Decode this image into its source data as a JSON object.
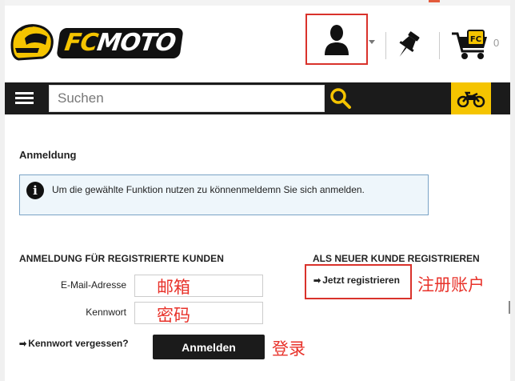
{
  "header": {
    "logo_text_fc": "FC",
    "logo_text_moto": "MOTO",
    "cart_count": "0"
  },
  "search": {
    "placeholder": "Suchen"
  },
  "login": {
    "title": "Anmeldung",
    "info_message": "Um die gewählte Funktion nutzen zu könnenmeldemn Sie sich anmelden.",
    "registered_heading": "ANMELDUNG FÜR REGISTRIERTE KUNDEN",
    "email_label": "E-Mail-Adresse",
    "password_label": "Kennwort",
    "forgot_link": "Kennwort vergessen?",
    "submit_label": "Anmelden",
    "new_customer_heading": "ALS NEUER KUNDE REGISTRIEREN",
    "register_link": "Jetzt registrieren"
  },
  "annotations": {
    "email": "邮箱",
    "password": "密码",
    "register": "注册账户",
    "login": "登录"
  },
  "icons": [
    "hamburger-icon",
    "search-icon",
    "motorcycle-icon",
    "user-icon",
    "pin-icon",
    "cart-icon",
    "info-icon",
    "arrow-right-icon"
  ],
  "colors": {
    "brand_yellow": "#f5c400",
    "bar_dark": "#1b1b1b",
    "annotation_red": "#e8322a",
    "info_bg": "#eef6fb",
    "info_border": "#7aa3c6"
  }
}
